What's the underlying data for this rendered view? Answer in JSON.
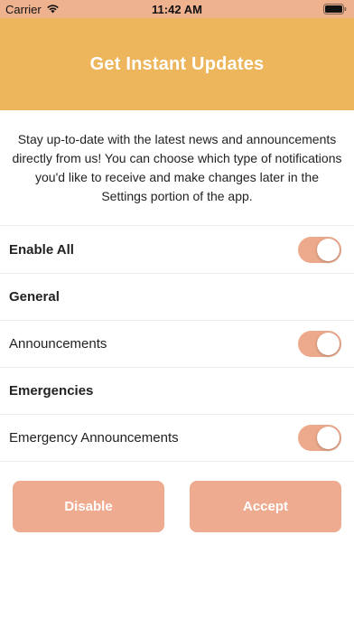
{
  "status_bar": {
    "carrier": "Carrier",
    "time": "11:42 AM",
    "wifi_icon": "wifi-icon",
    "battery_icon": "battery-icon"
  },
  "header": {
    "title": "Get Instant Updates",
    "background": "#edb55c"
  },
  "intro": {
    "text": "Stay up-to-date with the latest news and announcements directly from us! You can choose which type of notifications you'd like to receive and make changes later in the Settings portion of the app."
  },
  "settings": {
    "enable_all": {
      "label": "Enable All",
      "on": true
    },
    "general": {
      "label": "General"
    },
    "announcements": {
      "label": "Announcements",
      "on": true
    },
    "emergencies": {
      "label": "Emergencies"
    },
    "emergency_announcements": {
      "label": "Emergency Announcements",
      "on": true
    }
  },
  "actions": {
    "disable_label": "Disable",
    "accept_label": "Accept"
  },
  "colors": {
    "accent": "#eeab90",
    "toggle_on": "#eda98b"
  }
}
